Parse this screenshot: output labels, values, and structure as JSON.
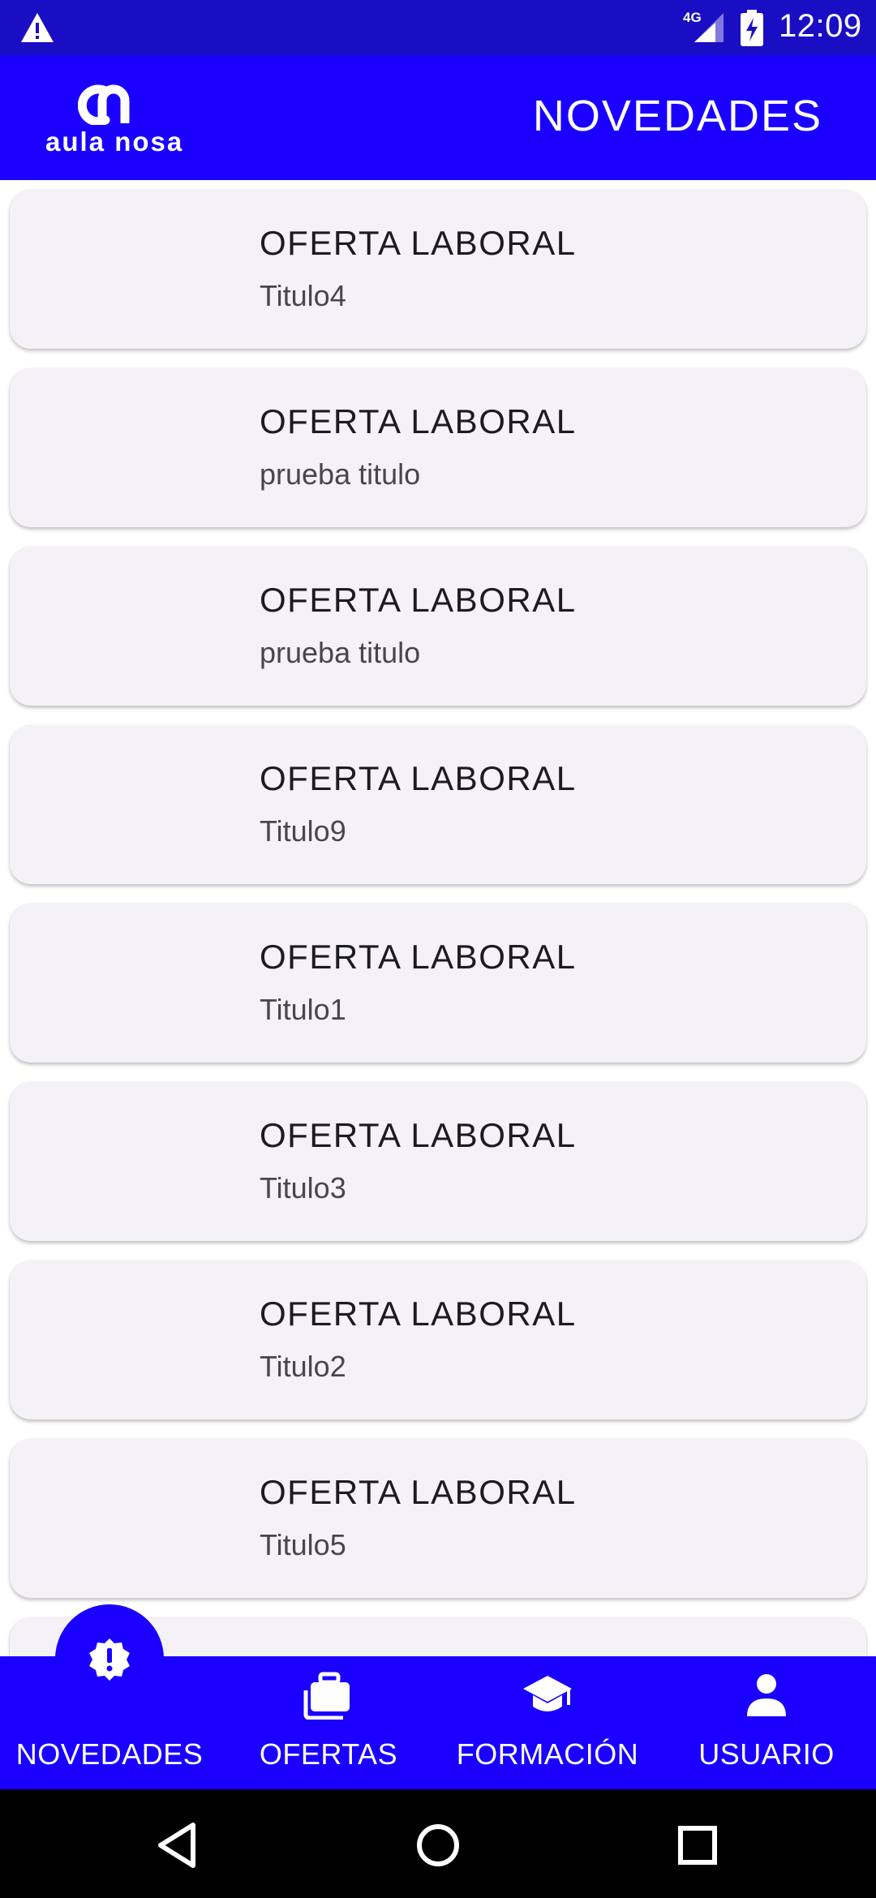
{
  "status_bar": {
    "network": "4G",
    "time": "12:09"
  },
  "app_bar": {
    "logo_text": "aula nosa",
    "title": "NOVEDADES"
  },
  "list": {
    "items": [
      {
        "title": "OFERTA LABORAL",
        "subtitle": "Titulo4"
      },
      {
        "title": "OFERTA LABORAL",
        "subtitle": "prueba titulo"
      },
      {
        "title": "OFERTA LABORAL",
        "subtitle": "prueba titulo"
      },
      {
        "title": "OFERTA LABORAL",
        "subtitle": "Titulo9"
      },
      {
        "title": "OFERTA LABORAL",
        "subtitle": "Titulo1"
      },
      {
        "title": "OFERTA LABORAL",
        "subtitle": "Titulo3"
      },
      {
        "title": "OFERTA LABORAL",
        "subtitle": "Titulo2"
      },
      {
        "title": "OFERTA LABORAL",
        "subtitle": "Titulo5"
      }
    ]
  },
  "bottom_nav": {
    "active": "novedades",
    "items": [
      {
        "id": "novedades",
        "label": "NOVEDADES",
        "icon": "alert-badge-icon"
      },
      {
        "id": "ofertas",
        "label": "OFERTAS",
        "icon": "briefcase-icon"
      },
      {
        "id": "formacion",
        "label": "FORMACIÓN",
        "icon": "graduation-cap-icon"
      },
      {
        "id": "usuario",
        "label": "USUARIO",
        "icon": "person-icon"
      }
    ]
  },
  "colors": {
    "primary": "#1900ff",
    "status_bar": "#1a0ec4",
    "card_background": "#f4f1f7",
    "nav_text": "#ffffff"
  }
}
